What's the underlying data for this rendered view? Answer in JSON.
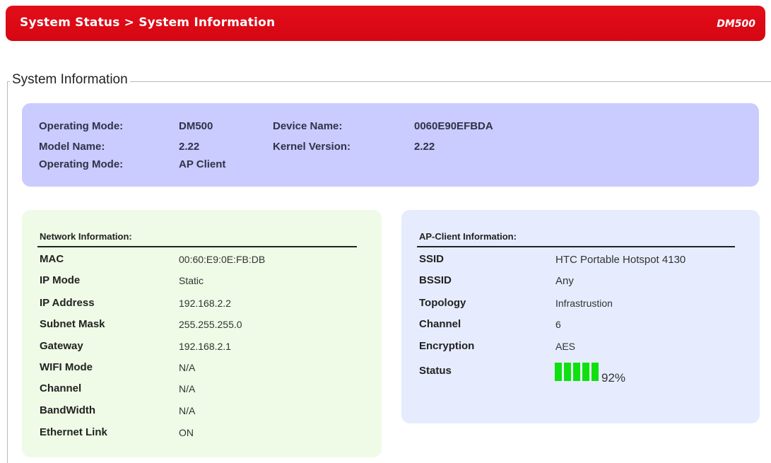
{
  "header": {
    "title": "System Status > System Information",
    "model": "DM500"
  },
  "section": {
    "legend": "System Information"
  },
  "system_info": {
    "operating_mode_label": "Operating Mode:",
    "operating_mode_value": "DM500",
    "model_name_label": "Model Name:",
    "model_name_value": "2.22",
    "operating_mode2_label": "Operating Mode:",
    "operating_mode2_value": "AP Client",
    "device_name_label": "Device Name:",
    "device_name_value": "0060E90EFBDA",
    "kernel_version_label": "Kernel Version:",
    "kernel_version_value": "2.22"
  },
  "network": {
    "heading": "Network Information:",
    "rows": [
      {
        "label": "MAC",
        "value": "00:60:E9:0E:FB:DB"
      },
      {
        "label": "IP Mode",
        "value": "Static"
      },
      {
        "label": "IP Address",
        "value": "192.168.2.2"
      },
      {
        "label": "Subnet Mask",
        "value": "255.255.255.0"
      },
      {
        "label": "Gateway",
        "value": "192.168.2.1"
      },
      {
        "label": "WIFI Mode",
        "value": "N/A"
      },
      {
        "label": "Channel",
        "value": "N/A"
      },
      {
        "label": "BandWidth",
        "value": "N/A"
      },
      {
        "label": "Ethernet Link",
        "value": "ON"
      }
    ]
  },
  "ap_client": {
    "heading": "AP-Client Information:",
    "rows": [
      {
        "label": "SSID",
        "value": "HTC Portable Hotspot 4130"
      },
      {
        "label": "BSSID",
        "value": "Any"
      },
      {
        "label": "Topology",
        "value": "Infrastrustion"
      },
      {
        "label": "Channel",
        "value": "6"
      },
      {
        "label": "Encryption",
        "value": "AES"
      }
    ],
    "status_label": "Status",
    "signal_percent": "92%",
    "signal_bars_filled": 5,
    "signal_color": "#10e010"
  },
  "colors": {
    "header": "#e30d1a",
    "system_box": "#cacbff",
    "network_panel": "#effbe6",
    "ap_panel": "#e6ecfd"
  }
}
